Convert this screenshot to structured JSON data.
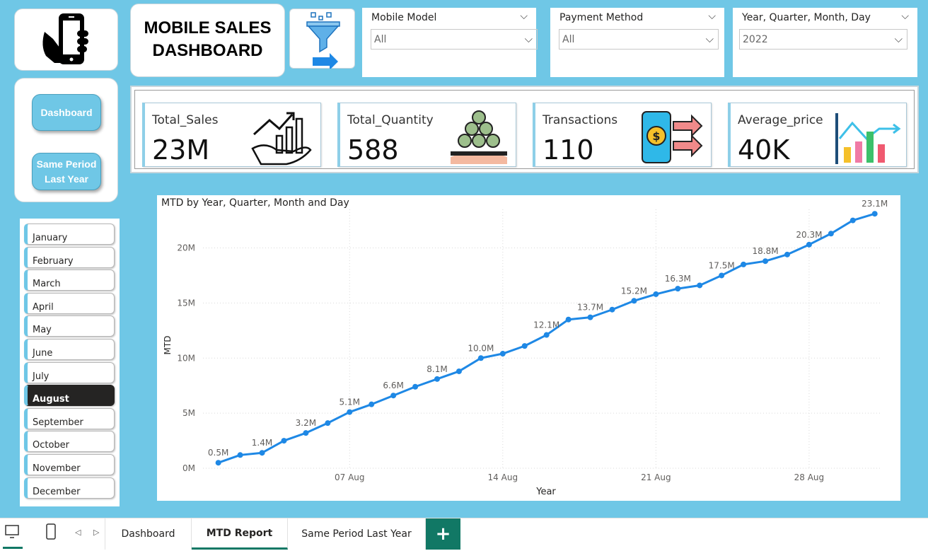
{
  "dashboard": {
    "title_line1": "MOBILE SALES",
    "title_line2": "DASHBOARD"
  },
  "nav": {
    "dashboard_label": "Dashboard",
    "same_period_line1": "Same Period",
    "same_period_line2": "Last Year"
  },
  "slicers": {
    "mobile_model": {
      "header": "Mobile Model",
      "value": "All"
    },
    "payment_method": {
      "header": "Payment Method",
      "value": "All"
    },
    "date": {
      "header": "Year, Quarter, Month, Day",
      "value": "2022"
    }
  },
  "kpis": [
    {
      "label": "Total_Sales",
      "value": "23M"
    },
    {
      "label": "Total_Quantity",
      "value": "588"
    },
    {
      "label": "Transactions",
      "value": "110"
    },
    {
      "label": "Average_price",
      "value": "40K"
    }
  ],
  "months": [
    "January",
    "February",
    "March",
    "April",
    "May",
    "June",
    "July",
    "August",
    "September",
    "October",
    "November",
    "December"
  ],
  "selected_month": "August",
  "chart_data": {
    "type": "line",
    "title": "MTD by Year, Quarter, Month and Day",
    "xlabel": "Year",
    "ylabel": "MTD",
    "ylim": [
      0,
      23.5
    ],
    "y_unit": "M",
    "y_ticks": [
      "0M",
      "5M",
      "10M",
      "15M",
      "20M"
    ],
    "x_ticks": [
      "07 Aug",
      "14 Aug",
      "21 Aug",
      "28 Aug"
    ],
    "x_tick_days": [
      7,
      14,
      21,
      28
    ],
    "x": [
      1,
      2,
      3,
      4,
      5,
      6,
      7,
      8,
      9,
      10,
      11,
      12,
      13,
      14,
      15,
      16,
      17,
      18,
      19,
      20,
      21,
      22,
      23,
      24,
      25,
      26,
      27,
      28,
      29,
      30,
      31
    ],
    "series": [
      {
        "values": [
          0.5,
          1.2,
          1.4,
          2.5,
          3.2,
          4.1,
          5.1,
          5.8,
          6.6,
          7.4,
          8.1,
          8.8,
          10.0,
          10.4,
          11.1,
          12.1,
          13.5,
          13.7,
          14.4,
          15.2,
          15.8,
          16.3,
          16.6,
          17.5,
          18.5,
          18.8,
          19.4,
          20.3,
          21.3,
          22.5,
          23.1
        ],
        "labels": {
          "1": "0.5M",
          "3": "1.4M",
          "5": "3.2M",
          "7": "5.1M",
          "9": "6.6M",
          "11": "8.1M",
          "13": "10.0M",
          "16": "12.1M",
          "18": "13.7M",
          "20": "15.2M",
          "22": "16.3M",
          "24": "17.5M",
          "26": "18.8M",
          "28": "20.3M",
          "31": "23.1M"
        }
      }
    ],
    "grid": true,
    "color": "#1e88e5"
  },
  "tabs": {
    "dashboard": "Dashboard",
    "mtd_report": "MTD Report",
    "same_period": "Same Period Last Year",
    "add": "+"
  }
}
